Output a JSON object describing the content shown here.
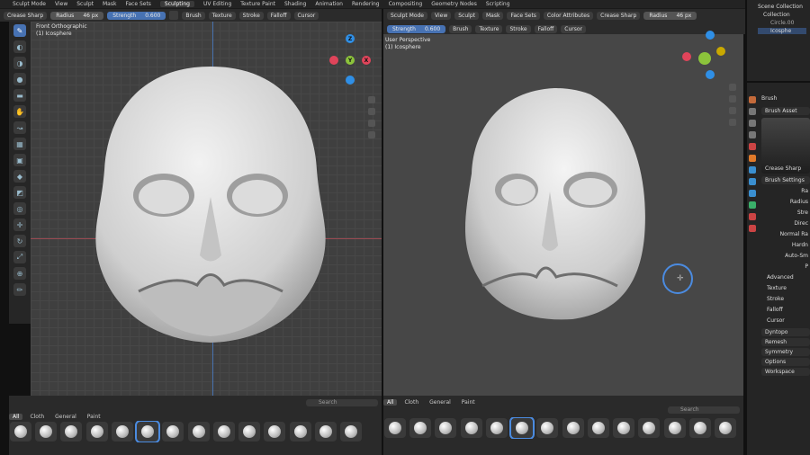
{
  "topbar": {
    "mode": "Sculpt Mode",
    "menus": [
      "View",
      "Sculpt",
      "Mask",
      "Face Sets"
    ],
    "workspaces": [
      "Sculpting",
      "UV Editing",
      "Texture Paint",
      "Shading",
      "Animation",
      "Rendering",
      "Compositing",
      "Geometry Nodes",
      "Scripting"
    ],
    "color_attributes": "Color Attributes"
  },
  "left_header": {
    "brush_name": "Crease Sharp",
    "radius_label": "Radius",
    "radius_value": "46 px",
    "strength_label": "Strength",
    "strength_value": "0.600",
    "menus": [
      "Brush",
      "Texture",
      "Stroke",
      "Falloff",
      "Cursor"
    ]
  },
  "left_viewport": {
    "view_name": "Front Orthographic",
    "object_name": "(1) Icosphere"
  },
  "right_header": {
    "mode": "Sculpt Mode",
    "menus": [
      "View",
      "Sculpt",
      "Mask",
      "Face Sets"
    ],
    "color_attributes": "Color Attributes",
    "brush_name": "Crease Sharp",
    "radius_label": "Radius",
    "radius_value": "46 px",
    "strength_label": "Strength",
    "strength_value": "0.600",
    "tool_menus": [
      "Brush",
      "Texture",
      "Stroke",
      "Falloff",
      "Cursor"
    ]
  },
  "right_viewport": {
    "view_name": "User Perspective",
    "object_name": "(1) Icosphere"
  },
  "gizmo": {
    "x": "X",
    "y": "Y",
    "z": "Z"
  },
  "shelf": {
    "tabs": [
      "All",
      "Cloth",
      "General",
      "Paint"
    ],
    "search_placeholder": "Search"
  },
  "outliner": {
    "scene_collection": "Scene Collection",
    "collection": "Collection",
    "items": [
      "Circle.00",
      "Icosphe"
    ]
  },
  "properties": {
    "brush_label": "Brush",
    "brush_asset": "Brush Asset",
    "asset_name": "Crease Sharp",
    "brush_settings": "Brush Settings",
    "settings_rows": [
      "Ra",
      "Radius",
      "Stre",
      "Direc",
      "Normal Ra",
      "Hardn",
      "Auto-Sm",
      "P"
    ],
    "panels": [
      "Advanced",
      "Texture",
      "Stroke",
      "Falloff",
      "Cursor"
    ],
    "sections": [
      "Dyntopo",
      "Remesh",
      "Symmetry",
      "Options",
      "Workspace"
    ]
  },
  "colors": {
    "accent": "#4772b3",
    "x_axis": "#e0445a",
    "y_axis": "#8cc33b",
    "z_axis": "#2f8fe6",
    "mesh": "#dcdcdc"
  }
}
